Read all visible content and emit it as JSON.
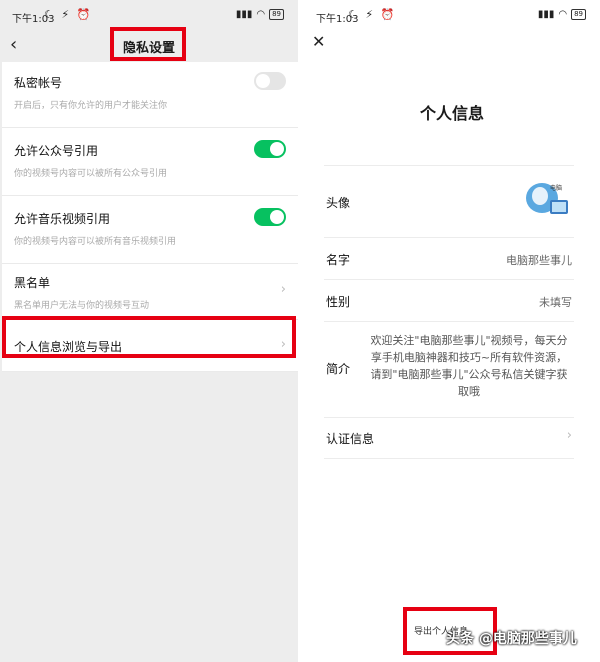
{
  "status": {
    "time": "下午1:03",
    "icons": "☾ ⚡ ⏰",
    "battery": "89"
  },
  "left": {
    "title": "隐私设置",
    "items": [
      {
        "label": "私密帐号",
        "sub": "开启后，只有你允许的用户才能关注你",
        "toggle": "off"
      },
      {
        "label": "允许公众号引用",
        "sub": "你的视频号内容可以被所有公众号引用",
        "toggle": "on"
      },
      {
        "label": "允许音乐视频引用",
        "sub": "你的视频号内容可以被所有音乐视频引用",
        "toggle": "on"
      },
      {
        "label": "黑名单",
        "sub": "黑名单用户无法与你的视频号互动",
        "toggle": "none"
      },
      {
        "label": "个人信息浏览与导出",
        "sub": "",
        "toggle": "none"
      }
    ]
  },
  "right": {
    "title": "个人信息",
    "avatar_label": "头像",
    "avatar_text": "电脑",
    "name_label": "名字",
    "name_value": "电脑那些事儿",
    "gender_label": "性别",
    "gender_value": "未填写",
    "bio_label": "简介",
    "bio_value": "欢迎关注\"电脑那些事儿\"视频号，每天分享手机电脑神器和技巧~所有软件资源，请到\"电脑那些事儿\"公众号私信关键字获取哦",
    "cert_label": "认证信息",
    "export_label": "导出个人信息",
    "watermark": "头条 @电脑那些事儿"
  },
  "colors": {
    "highlight": "#e60012",
    "toggle_on": "#07c160"
  },
  "icons": {
    "back": "chevron-left-icon",
    "close": "close-icon",
    "chevron": "chevron-right-icon"
  }
}
